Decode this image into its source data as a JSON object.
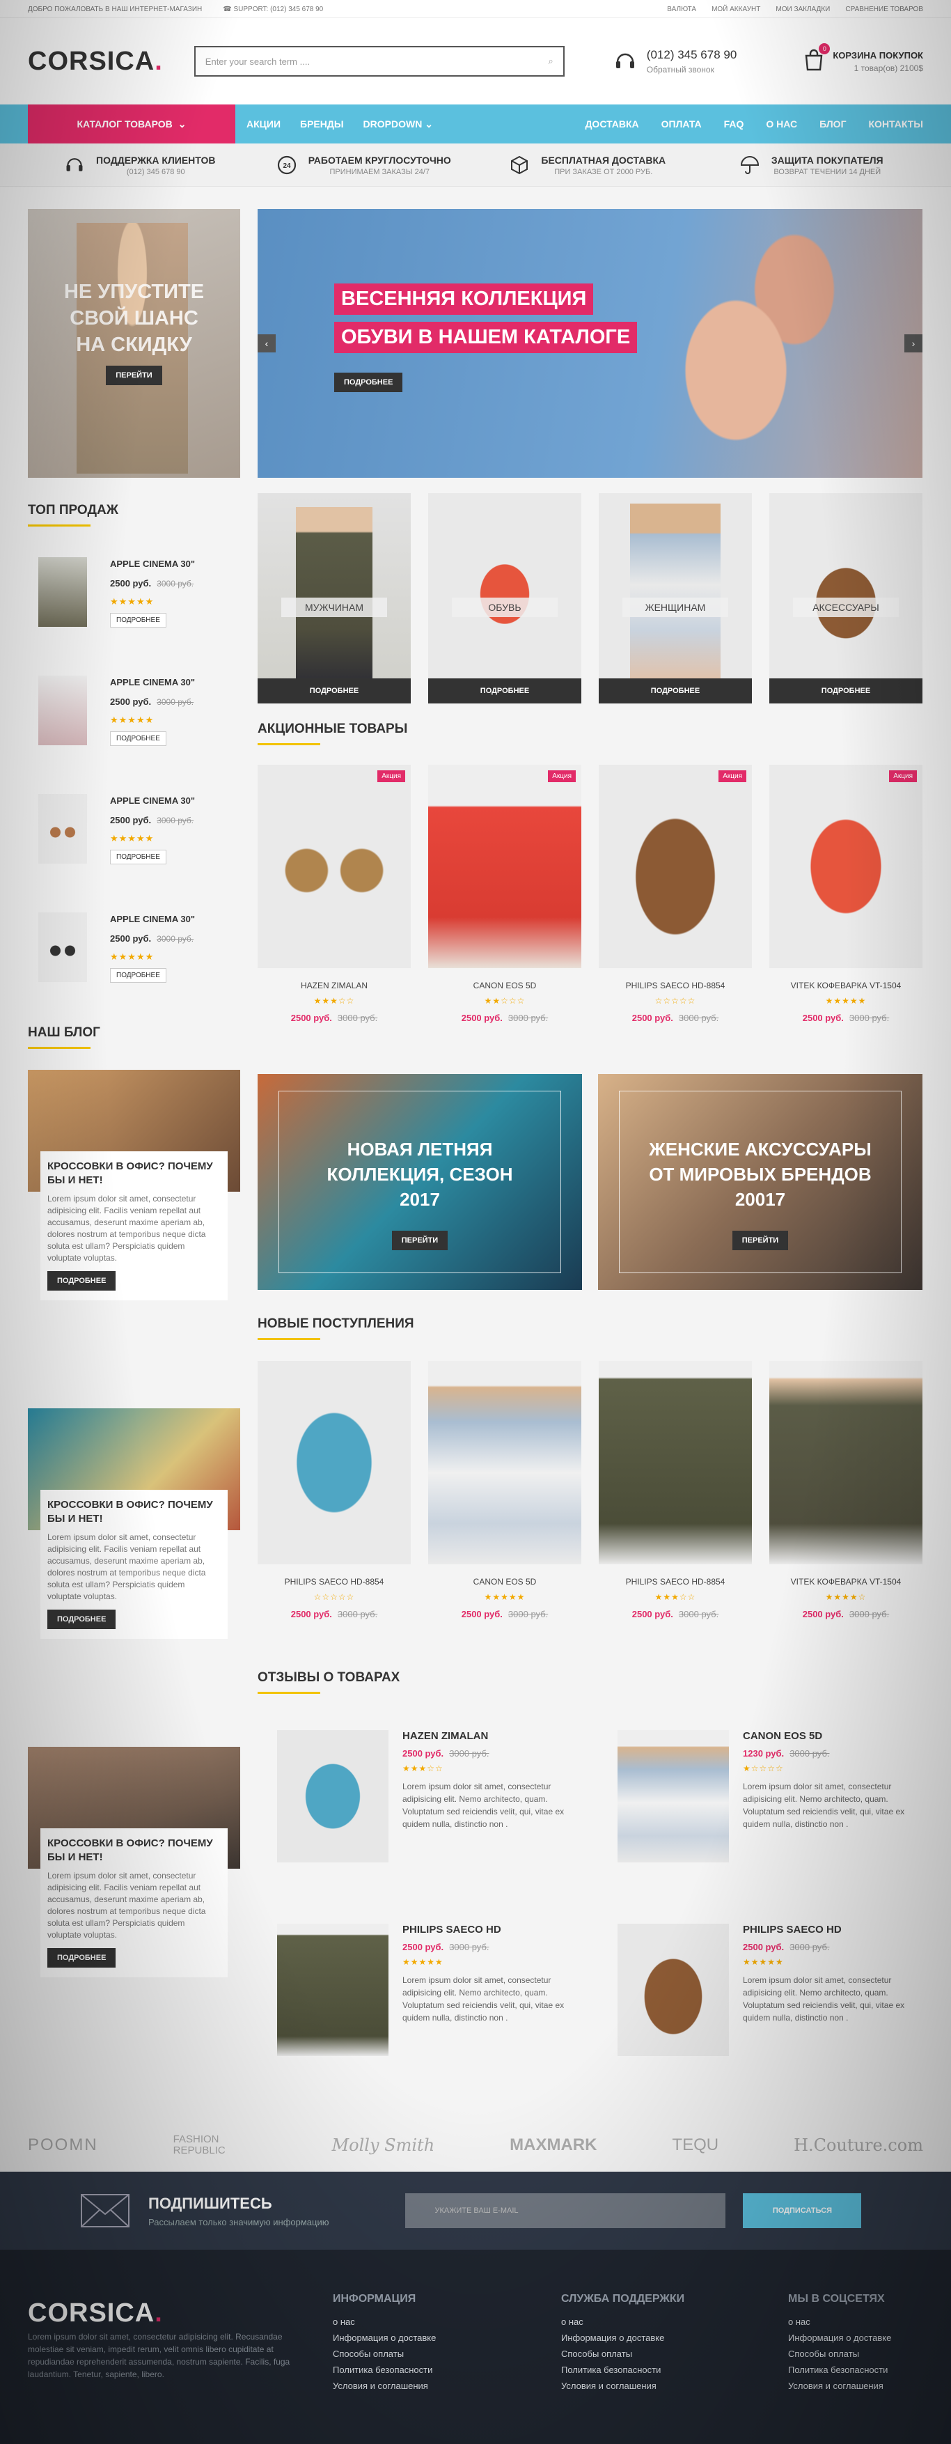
{
  "topbar": {
    "welcome": "ДОБРО ПОЖАЛОВАТЬ В НАШ ИНТЕРНЕТ-МАГАЗИН",
    "support": "SUPPORT: (012) 345 678 90",
    "links": [
      "ВАЛЮТА",
      "МОЙ АККАУНТ",
      "МОИ ЗАКЛАДКИ",
      "СРАВНЕНИЕ ТОВАРОВ"
    ]
  },
  "header": {
    "logo": "CORSICA",
    "logo_dot": ".",
    "search_placeholder": "Enter your search term ....",
    "phone": "(012) 345 678 90",
    "phone_sub": "Обратный звонок",
    "cart_title": "КОРЗИНА ПОКУПОК",
    "cart_sub": "1 товар(ов) 2100$",
    "cart_count": "0"
  },
  "nav": {
    "catalog": "КАТАЛОГ ТОВАРОВ",
    "items_left": [
      "АКЦИИ",
      "БРЕНДЫ",
      "DROPDOWN"
    ],
    "items_right": [
      "ДОСТАВКА",
      "ОПЛАТА",
      "FAQ",
      "О НАС",
      "БЛОГ",
      "КОНТАКТЫ"
    ]
  },
  "features": [
    {
      "title": "ПОДДЕРЖКА КЛИЕНТОВ",
      "sub": "(012) 345 678 90",
      "icon": "headset-icon"
    },
    {
      "title": "РАБОТАЕМ КРУГЛОСУТОЧНО",
      "sub": "ПРИНИМАЕМ ЗАКАЗЫ 24/7",
      "icon": "clock-24-icon"
    },
    {
      "title": "БЕСПЛАТНАЯ ДОСТАВКА",
      "sub": "ПРИ ЗАКАЗЕ ОТ 2000 РУБ.",
      "icon": "box-icon"
    },
    {
      "title": "ЗАЩИТА ПОКУПАТЕЛЯ",
      "sub": "ВОЗВРАТ ТЕЧЕНИИ 14 ДНЕЙ",
      "icon": "umbrella-icon"
    }
  ],
  "side_banner": {
    "text": "НЕ УПУСТИТЕ СВОЙ ШАНС НА СКИДКУ",
    "button": "ПЕРЕЙТИ"
  },
  "slider": {
    "line1": "ВЕСЕННЯЯ КОЛЛЕКЦИЯ",
    "line2": "ОБУВИ В НАШЕМ КАТАЛОГЕ",
    "button": "ПОДРОБНЕЕ"
  },
  "top_sales": {
    "title": "ТОП ПРОДАЖ",
    "items": [
      {
        "name": "APPLE CINEMA 30\"",
        "price": "2500 руб.",
        "old": "3000 руб.",
        "stars": "★★★★★",
        "button": "ПОДРОБНЕЕ"
      },
      {
        "name": "APPLE CINEMA 30\"",
        "price": "2500 руб.",
        "old": "3000 руб.",
        "stars": "★★★★★",
        "button": "ПОДРОБНЕЕ"
      },
      {
        "name": "APPLE CINEMA 30\"",
        "price": "2500 руб.",
        "old": "3000 руб.",
        "stars": "★★★★★",
        "button": "ПОДРОБНЕЕ"
      },
      {
        "name": "APPLE CINEMA 30\"",
        "price": "2500 руб.",
        "old": "3000 руб.",
        "stars": "★★★★★",
        "button": "ПОДРОБНЕЕ"
      }
    ]
  },
  "categories": [
    {
      "label": "МУЖЧИНАМ",
      "button": "ПОДРОБНЕЕ"
    },
    {
      "label": "ОБУВЬ",
      "button": "ПОДРОБНЕЕ"
    },
    {
      "label": "ЖЕНЩИНАМ",
      "button": "ПОДРОБНЕЕ"
    },
    {
      "label": "АКСЕССУАРЫ",
      "button": "ПОДРОБНЕЕ"
    }
  ],
  "sale_products": {
    "title": "АКЦИОННЫЕ ТОВАРЫ",
    "badge": "Акция",
    "items": [
      {
        "name": "HAZEN ZIMALAN",
        "stars": "★★★☆☆",
        "price": "2500 руб.",
        "old": "3000 руб."
      },
      {
        "name": "CANON EOS 5D",
        "stars": "★★☆☆☆",
        "price": "2500 руб.",
        "old": "3000 руб."
      },
      {
        "name": "PHILIPS SAECO HD-8854",
        "stars": "☆☆☆☆☆",
        "price": "2500 руб.",
        "old": "3000 руб."
      },
      {
        "name": "VITEK КОФЕВАРКА VT-1504",
        "stars": "★★★★★",
        "price": "2500 руб.",
        "old": "3000 руб."
      }
    ]
  },
  "blog": {
    "title": "НАШ БЛОГ",
    "posts": [
      {
        "title": "КРОССОВКИ В ОФИС? ПОЧЕМУ БЫ И НЕТ!",
        "text": "Lorem ipsum dolor sit amet, consectetur adipisicing elit. Facilis veniam repellat aut accusamus, deserunt maxime aperiam ab, dolores nostrum at temporibus neque dicta soluta est ullam? Perspiciatis quidem voluptate voluptas.",
        "button": "ПОДРОБНЕЕ"
      },
      {
        "title": "КРОССОВКИ В ОФИС? ПОЧЕМУ БЫ И НЕТ!",
        "text": "Lorem ipsum dolor sit amet, consectetur adipisicing elit. Facilis veniam repellat aut accusamus, deserunt maxime aperiam ab, dolores nostrum at temporibus neque dicta soluta est ullam? Perspiciatis quidem voluptate voluptas.",
        "button": "ПОДРОБНЕЕ"
      },
      {
        "title": "КРОССОВКИ В ОФИС? ПОЧЕМУ БЫ И НЕТ!",
        "text": "Lorem ipsum dolor sit amet, consectetur adipisicing elit. Facilis veniam repellat aut accusamus, deserunt maxime aperiam ab, dolores nostrum at temporibus neque dicta soluta est ullam? Perspiciatis quidem voluptate voluptas.",
        "button": "ПОДРОБНЕЕ"
      }
    ]
  },
  "promos": [
    {
      "text": "НОВАЯ ЛЕТНЯЯ КОЛЛЕКЦИЯ, СЕЗОН 2017",
      "button": "ПЕРЕЙТИ"
    },
    {
      "text": "ЖЕНСКИЕ АКСУССУАРЫ ОТ МИРОВЫХ БРЕНДОВ 20017",
      "button": "ПЕРЕЙТИ"
    }
  ],
  "new_products": {
    "title": "НОВЫЕ ПОСТУПЛЕНИЯ",
    "items": [
      {
        "name": "PHILIPS SAECO HD-8854",
        "stars": "☆☆☆☆☆",
        "price": "2500 руб.",
        "old": "3000 руб."
      },
      {
        "name": "CANON EOS 5D",
        "stars": "★★★★★",
        "price": "2500 руб.",
        "old": "3000 руб."
      },
      {
        "name": "PHILIPS SAECO HD-8854",
        "stars": "★★★☆☆",
        "price": "2500 руб.",
        "old": "3000 руб."
      },
      {
        "name": "VITEK КОФЕВАРКА VT-1504",
        "stars": "★★★★☆",
        "price": "2500 руб.",
        "old": "3000 руб."
      }
    ]
  },
  "reviews": {
    "title": "ОТЗЫВЫ О ТОВАРАХ",
    "items": [
      {
        "name": "HAZEN ZIMALAN",
        "price": "2500 руб.",
        "old": "3000 руб.",
        "stars": "★★★☆☆",
        "text": "Lorem ipsum dolor sit amet, consectetur adipisicing elit. Nemo architecto, quam. Voluptatum sed reiciendis velit, qui, vitae ex quidem nulla, distinctio non ."
      },
      {
        "name": "CANON EOS 5D",
        "price": "1230 руб.",
        "old": "3000 руб.",
        "stars": "★☆☆☆☆",
        "text": "Lorem ipsum dolor sit amet, consectetur adipisicing elit. Nemo architecto, quam. Voluptatum sed reiciendis velit, qui, vitae ex quidem nulla, distinctio non ."
      },
      {
        "name": "PHILIPS SAECO HD",
        "price": "2500 руб.",
        "old": "3000 руб.",
        "stars": "★★★★★",
        "text": "Lorem ipsum dolor sit amet, consectetur adipisicing elit. Nemo architecto, quam. Voluptatum sed reiciendis velit, qui, vitae ex quidem nulla, distinctio non ."
      },
      {
        "name": "PHILIPS SAECO HD",
        "price": "2500 руб.",
        "old": "3000 руб.",
        "stars": "★★★★★",
        "text": "Lorem ipsum dolor sit amet, consectetur adipisicing elit. Nemo architecto, quam. Voluptatum sed reiciendis velit, qui, vitae ex quidem nulla, distinctio non ."
      }
    ]
  },
  "brands": [
    "POOMN",
    "FASHION REPUBLIC",
    "Molly Smith",
    "MAXMARK",
    "TEQU",
    "H.Couture.com"
  ],
  "newsletter": {
    "title": "ПОДПИШИТЕСЬ",
    "sub": "Рассылаем только значимую информацию",
    "placeholder": "УКАЖИТЕ ВАШ E-MAIL",
    "button": "ПОДПИСАТЬСЯ"
  },
  "footer": {
    "logo": "CORSICA",
    "about": "Lorem ipsum dolor sit amet, consectetur adipisicing elit. Recusandae molestiae sit veniam, impedit rerum, velit omnis libero cupiditate at repudiandae reprehenderit assumenda, nostrum sapiente. Facilis, fuga laudantium. Tenetur, sapiente, libero.",
    "columns": [
      {
        "title": "ИНФОРМАЦИЯ",
        "links": [
          "о нас",
          "Информация о доставке",
          "Способы оплаты",
          "Политика безопасности",
          "Условия и соглашения"
        ]
      },
      {
        "title": "СЛУЖБА ПОДДЕРЖКИ",
        "links": [
          "о нас",
          "Информация о доставке",
          "Способы оплаты",
          "Политика безопасности",
          "Условия и соглашения"
        ]
      },
      {
        "title": "МЫ В СОЦСЕТЯХ",
        "links": [
          "о нас",
          "Информация о доставке",
          "Способы оплаты",
          "Политика безопасности",
          "Условия и соглашения"
        ]
      }
    ]
  },
  "colors": {
    "accent": "#e22b68",
    "nav": "#5bc0de",
    "star": "#f2a900",
    "dark": "#333333"
  }
}
